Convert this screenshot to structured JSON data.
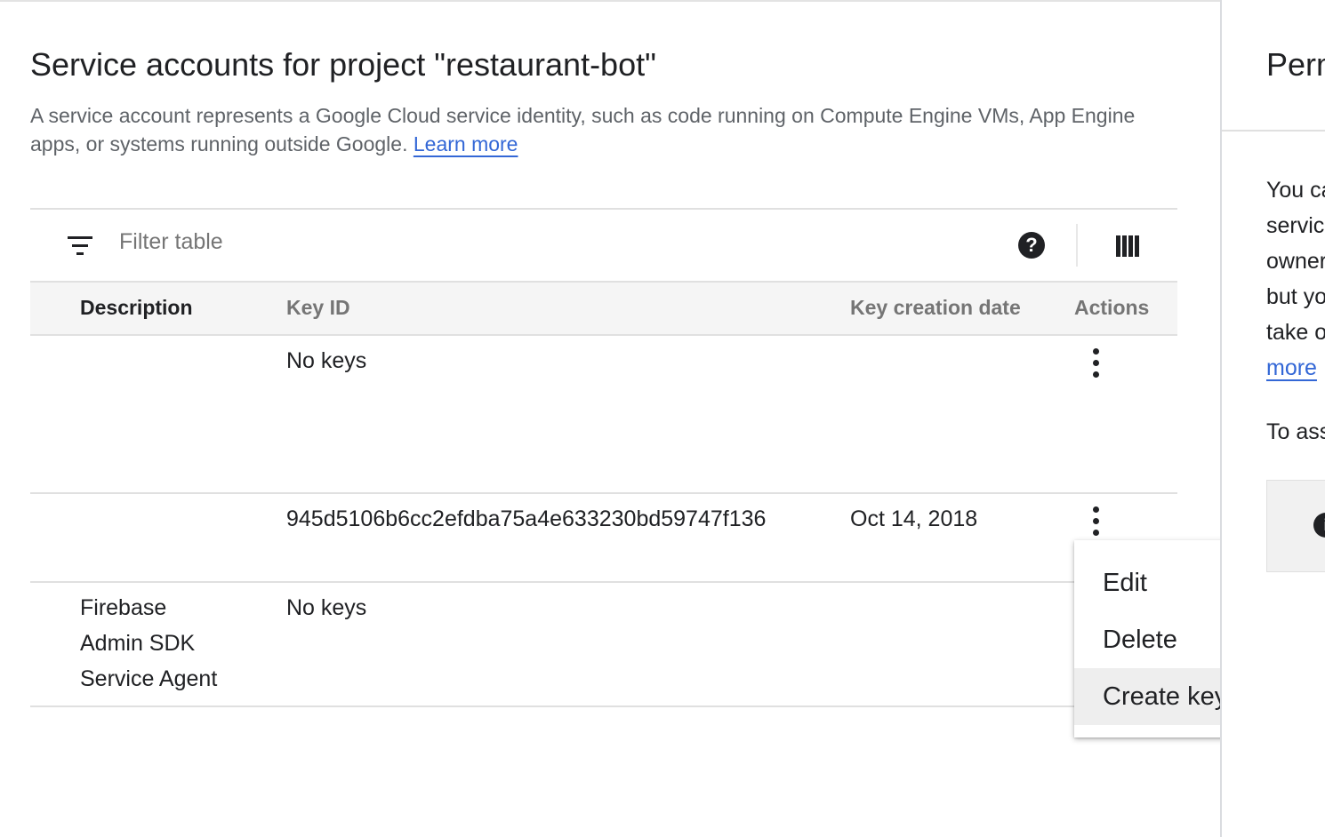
{
  "page": {
    "title": "Service accounts for project \"restaurant-bot\"",
    "description": "A service account represents a Google Cloud service identity, such as code running on Compute Engine VMs, App Engine apps, or systems running outside Google.",
    "learn_more": "Learn more"
  },
  "toolbar": {
    "filter_placeholder": "Filter table",
    "help_icon": "help-circle-icon",
    "help_glyph": "?",
    "columns_icon": "column-display-icon",
    "filter_icon": "filter-list-icon"
  },
  "table": {
    "headers": {
      "description": "Description",
      "key_id": "Key ID",
      "key_creation_date": "Key creation date",
      "actions": "Actions"
    },
    "rows": [
      {
        "description": [
          "",
          "",
          ""
        ],
        "key_id": "No keys",
        "key_creation_date": ""
      },
      {
        "description": [
          "",
          "",
          ""
        ],
        "key_id": "945d5106b6cc2efdba75a4e633230bd59747f136",
        "key_creation_date": "Oct 14, 2018"
      },
      {
        "description": [
          "Firebase",
          "Admin SDK",
          "Service Agent"
        ],
        "key_id": "No keys",
        "key_creation_date": ""
      }
    ]
  },
  "actions_menu": {
    "items": [
      "Edit",
      "Delete",
      "Create key"
    ],
    "highlighted": "Create key"
  },
  "side_panel": {
    "title": "Perm",
    "lines": [
      "You ca",
      "servic",
      "owner",
      "but yo",
      "take o"
    ],
    "link": "more",
    "footer": "To ass",
    "info_glyph": "i"
  },
  "colors": {
    "link": "#3367d6",
    "header_bg": "#f5f5f5",
    "menu_highlight": "#eeeeee"
  }
}
